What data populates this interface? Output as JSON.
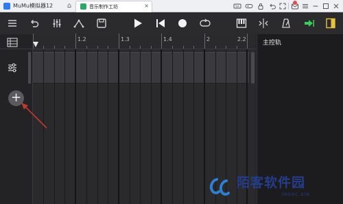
{
  "emulator": {
    "title": "MuMu模拟器12",
    "app_tab_label": "音乐制作工坊",
    "app_tab_close": "×",
    "tab_home_icon": "home-icon",
    "controls": [
      "keyboard-icon",
      "gamepad-icon",
      "lock-icon",
      "undo-icon",
      "fullscreen-icon",
      "mail-icon",
      "menu-icon",
      "minimize-icon",
      "maximize-icon",
      "close-icon"
    ],
    "notification_count": "",
    "notification_color": "#e84a4a"
  },
  "toolbar": {
    "icons": [
      "menu-icon",
      "undo-icon",
      "mixer-icon",
      "automation-icon",
      "save-icon",
      "play-icon",
      "skip-back-icon",
      "record-icon",
      "loop-icon",
      "piano-icon",
      "split-icon",
      "metronome-icon",
      "export-icon",
      "panel-toggle-icon"
    ],
    "export_color": "#35d05a",
    "panel_toggle_color": "#e8c33a"
  },
  "ruler": {
    "labels": [
      "1.2",
      "1.3",
      "1.4",
      "2",
      "2.2"
    ]
  },
  "tracks": {
    "add_icon": "plus-icon",
    "add_label": "+",
    "mixer_icon": "sliders-icon"
  },
  "right_panel": {
    "title": "主控轨"
  },
  "annotation": {
    "arrow_color": "#c0392b"
  },
  "watermark": {
    "title": "陌客软件园",
    "subtitle": "IMOOC.XIN",
    "color": "#243d8a"
  }
}
